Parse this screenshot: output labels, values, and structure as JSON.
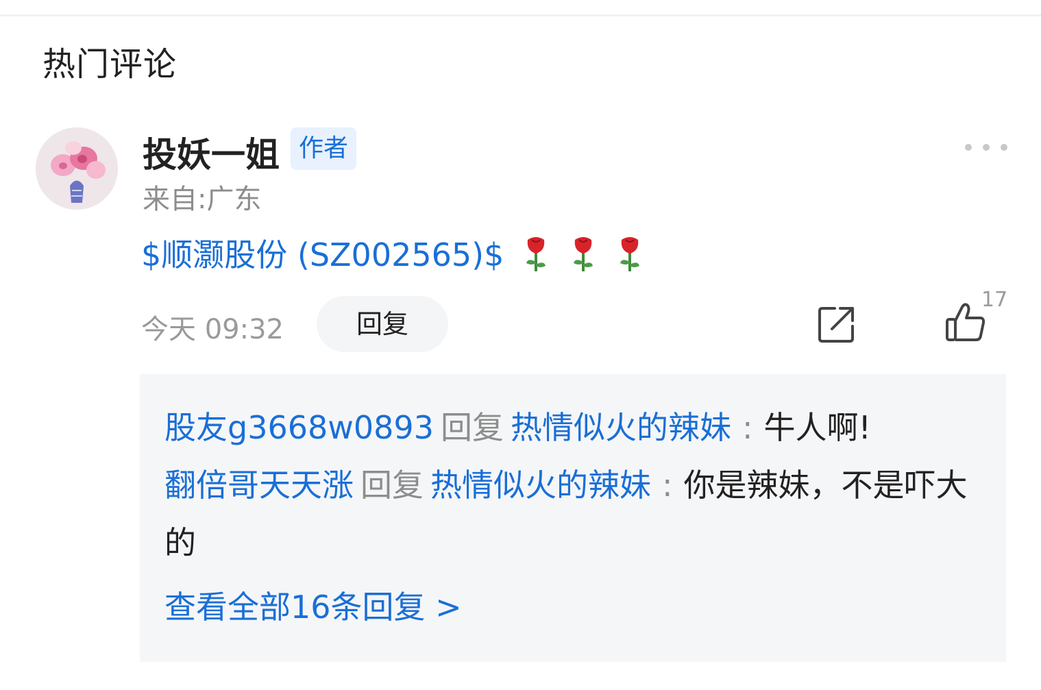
{
  "section": {
    "title": "热门评论"
  },
  "comment": {
    "username": "投妖一姐",
    "badge": "作者",
    "location": "来自:广东",
    "content": {
      "stock": "$顺灏股份 (SZ002565)$",
      "emoji_icons": [
        "rose-icon",
        "rose-icon",
        "rose-icon"
      ]
    },
    "time": "今天 09:32",
    "reply_label": "回复",
    "like_count": "17",
    "icons": {
      "more": "more-dots-icon",
      "share": "share-icon",
      "like": "thumbs-up-icon"
    }
  },
  "replies": [
    {
      "from": "股友g3668w0893",
      "verb": "回复",
      "to": "热情似火的辣妹",
      "colon": ":",
      "text": "牛人啊!"
    },
    {
      "from": "翻倍哥天天涨",
      "verb": "回复",
      "to": "热情似火的辣妹",
      "colon": ":",
      "text": "你是辣妹，不是吓大的"
    }
  ],
  "view_all": "查看全部16条回复 >",
  "colors": {
    "accent": "#1a6fd6",
    "muted": "#8d8d8d",
    "reply_bg": "#f5f6f8",
    "badge_bg": "#e8f1fd"
  }
}
